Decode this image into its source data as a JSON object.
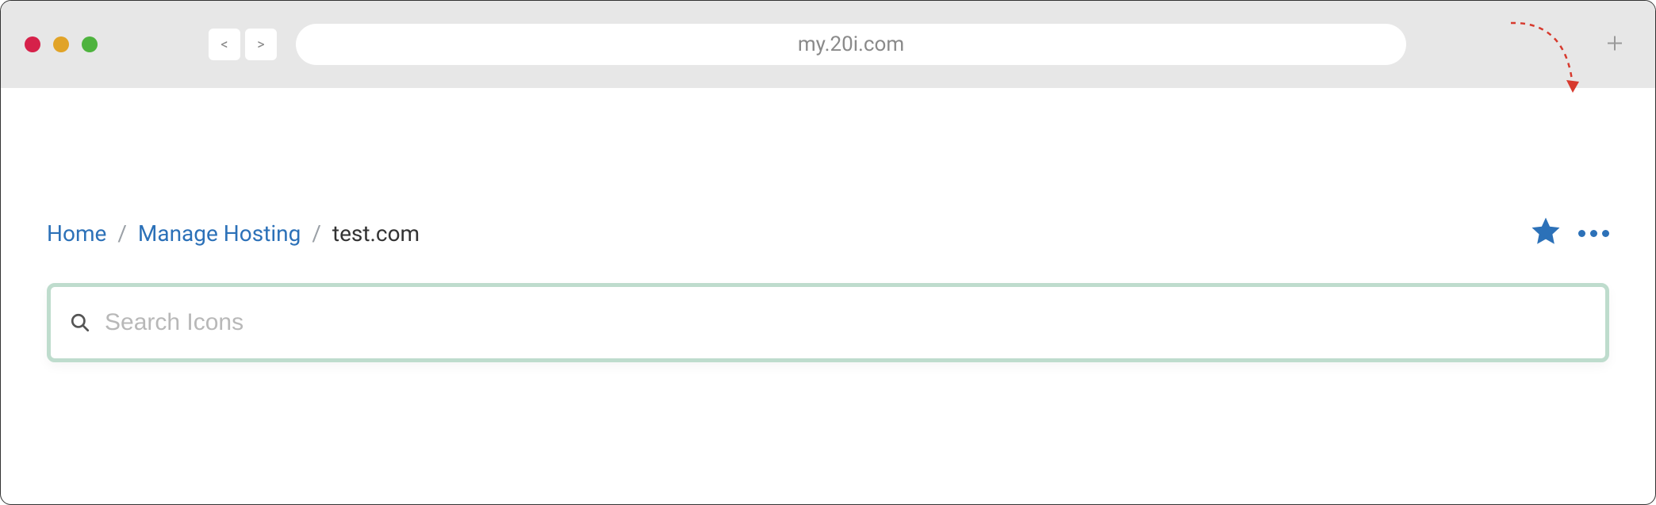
{
  "browser": {
    "url": "my.20i.com",
    "nav": {
      "back": "<",
      "forward": ">"
    }
  },
  "breadcrumb": {
    "home": "Home",
    "manage": "Manage Hosting",
    "current": "test.com",
    "sep": "/"
  },
  "search": {
    "placeholder": "Search Icons",
    "value": ""
  },
  "colors": {
    "link": "#2c71b8",
    "search_border": "#bedccd",
    "arrow": "#d73a2e"
  }
}
